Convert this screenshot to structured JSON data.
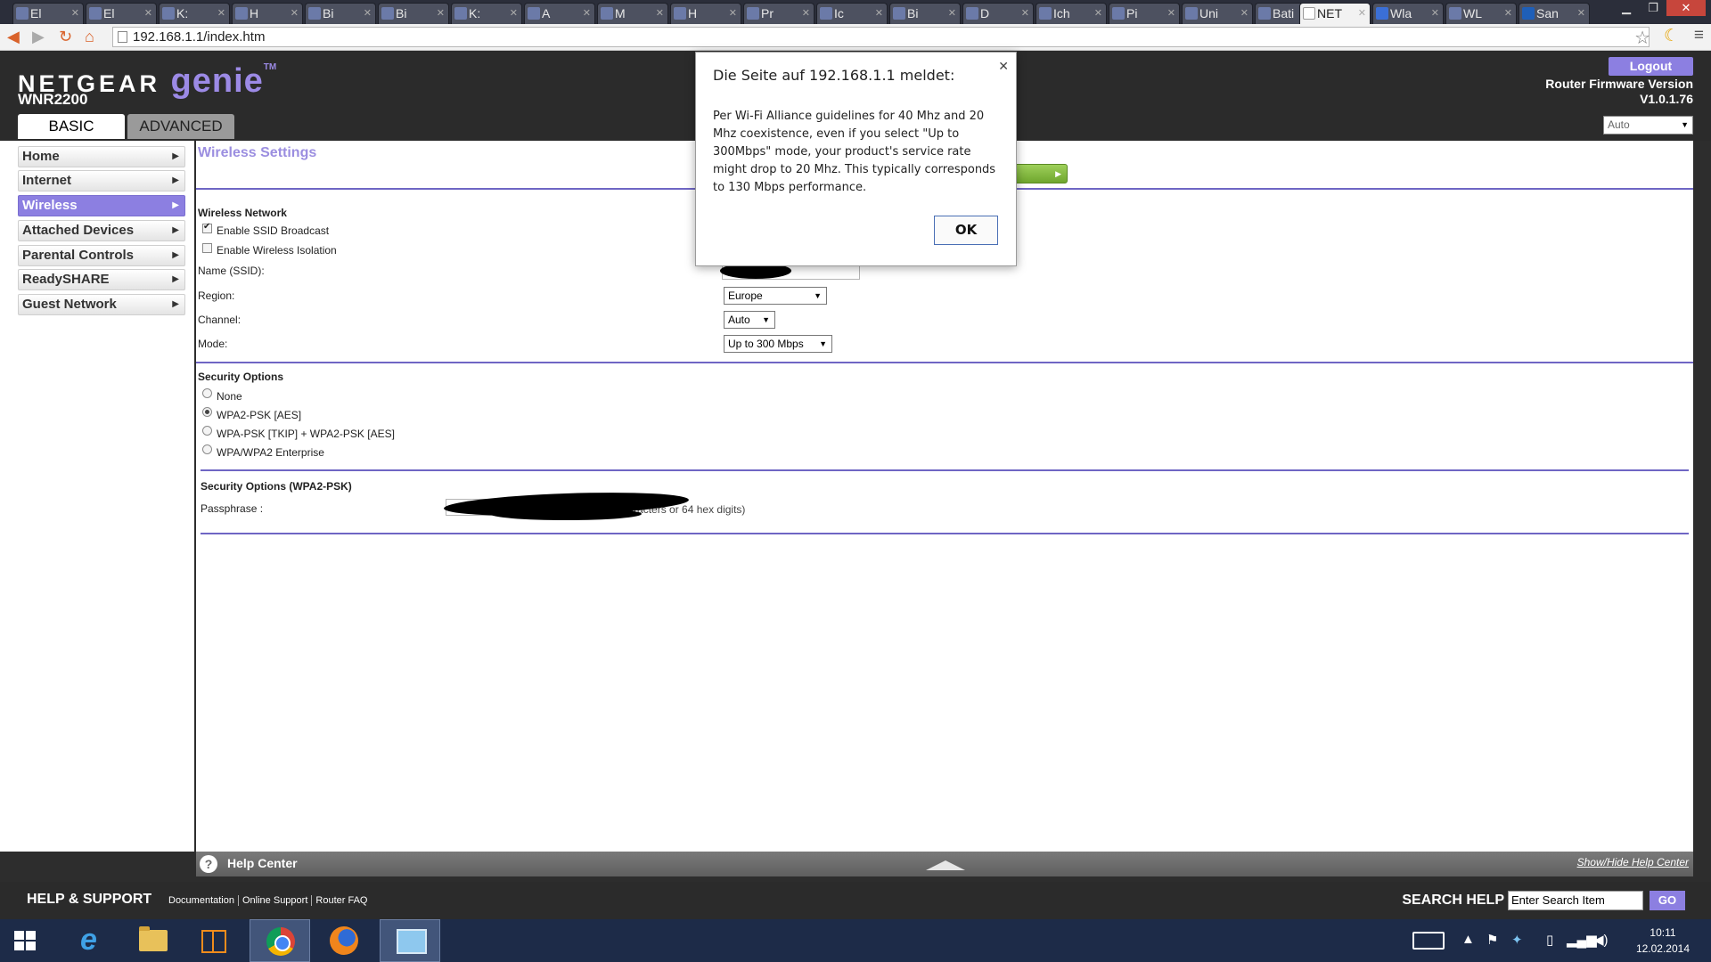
{
  "browser": {
    "tabs": [
      {
        "label": "El"
      },
      {
        "label": "El"
      },
      {
        "label": "K:"
      },
      {
        "label": "H"
      },
      {
        "label": "Bi"
      },
      {
        "label": "Bi"
      },
      {
        "label": "K:"
      },
      {
        "label": "A"
      },
      {
        "label": "M"
      },
      {
        "label": "H"
      },
      {
        "label": "Pr"
      },
      {
        "label": "Ic"
      },
      {
        "label": "Bi"
      },
      {
        "label": "D"
      },
      {
        "label": "Ich"
      },
      {
        "label": "Pi"
      },
      {
        "label": "Uni"
      },
      {
        "label": "Bati"
      },
      {
        "label": "NET"
      },
      {
        "label": "Wla"
      },
      {
        "label": "WL"
      },
      {
        "label": "San"
      }
    ],
    "active_tab_index": 18,
    "url": "192.168.1.1/index.htm"
  },
  "router": {
    "brand": "NETGEAR",
    "genie": "genie",
    "tm": "TM",
    "model": "WNR2200",
    "tabs": {
      "basic": "BASIC",
      "advanced": "ADVANCED"
    },
    "logout": "Logout",
    "firmware_label": "Router Firmware Version",
    "firmware_version": "V1.0.1.76",
    "language": "Auto",
    "sidebar": [
      {
        "label": "Home"
      },
      {
        "label": "Internet"
      },
      {
        "label": "Wireless"
      },
      {
        "label": "Attached Devices"
      },
      {
        "label": "Parental Controls"
      },
      {
        "label": "ReadySHARE"
      },
      {
        "label": "Guest Network"
      }
    ],
    "active_sidebar_index": 2,
    "content": {
      "title": "Wireless Settings",
      "apply_label": "ly",
      "wireless_network": {
        "heading": "Wireless Network",
        "enable_ssid": {
          "label": "Enable SSID Broadcast",
          "checked": true
        },
        "enable_isolation": {
          "label": "Enable Wireless Isolation",
          "checked": false
        },
        "name_label": "Name (SSID):",
        "region_label": "Region:",
        "region_value": "Europe",
        "channel_label": "Channel:",
        "channel_value": "Auto",
        "mode_label": "Mode:",
        "mode_value": "Up to 300 Mbps"
      },
      "security": {
        "heading": "Security Options",
        "options": [
          {
            "label": "None",
            "checked": false
          },
          {
            "label": "WPA2-PSK [AES]",
            "checked": true
          },
          {
            "label": "WPA-PSK [TKIP] + WPA2-PSK [AES]",
            "checked": false
          },
          {
            "label": "WPA/WPA2 Enterprise",
            "checked": false
          }
        ]
      },
      "psk": {
        "heading": "Security Options (WPA2-PSK)",
        "passphrase_label": "Passphrase :",
        "passphrase_hint": "63 characters or 64 hex digits)"
      }
    },
    "help": {
      "title": "Help Center",
      "toggle": "Show/Hide Help Center"
    },
    "footer": {
      "title": "HELP & SUPPORT",
      "links": [
        "Documentation",
        "Online Support",
        "Router FAQ"
      ],
      "search_title": "SEARCH HELP",
      "search_value": "Enter Search Item",
      "go": "GO"
    }
  },
  "dialog": {
    "title": "Die Seite auf 192.168.1.1 meldet:",
    "message": "Per Wi-Fi Alliance guidelines for 40 Mhz and 20 Mhz coexistence, even if you select \"Up to 300Mbps\" mode, your product's service rate might drop to 20 Mhz. This typically corresponds to 130 Mbps performance.",
    "ok": "OK"
  },
  "taskbar": {
    "time": "10:11",
    "date": "12.02.2014"
  }
}
